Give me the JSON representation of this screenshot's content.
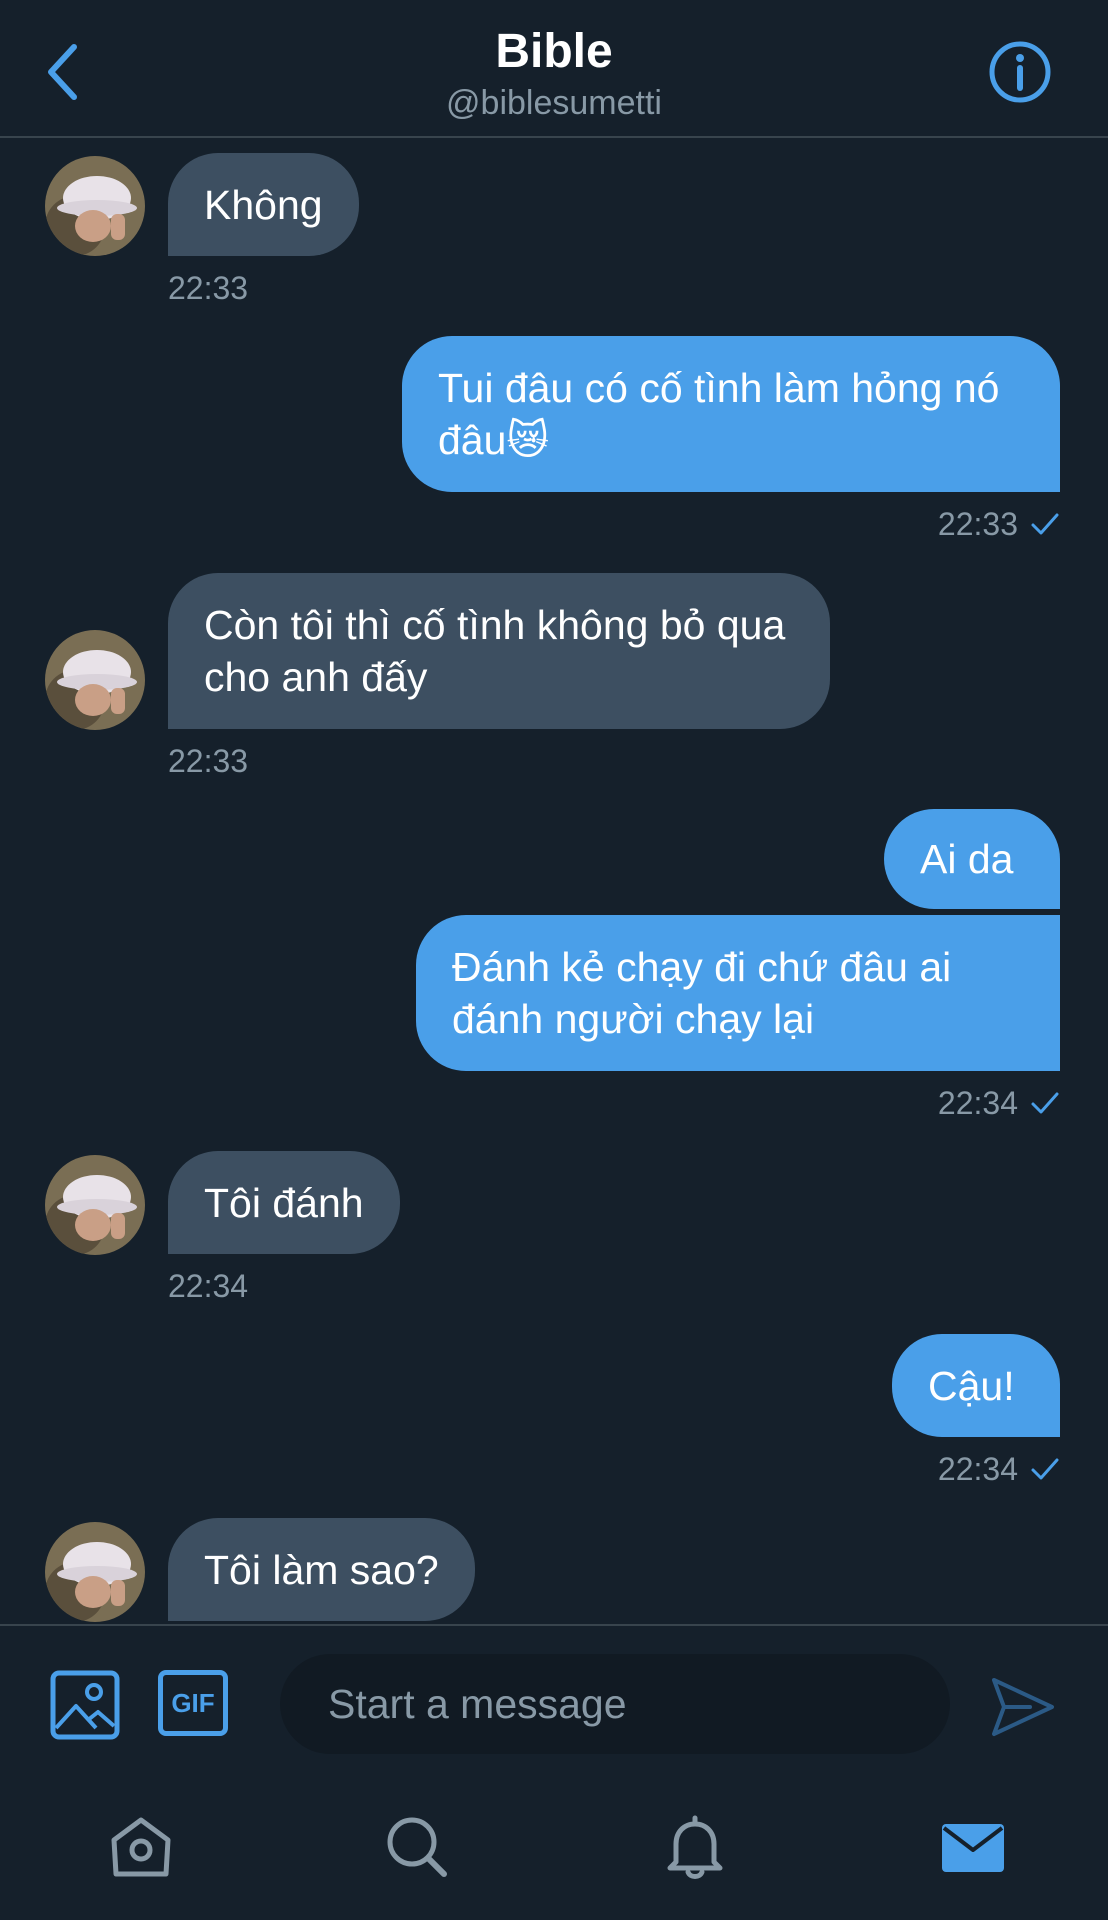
{
  "header": {
    "title": "Bible",
    "handle": "@biblesumetti",
    "back_icon": "chevron-left-icon",
    "info_icon": "info-circle-icon"
  },
  "messages": [
    {
      "side": "in",
      "text": "Không",
      "time": "22:33"
    },
    {
      "side": "out",
      "text": "Tui đâu có cố tình làm hỏng nó đâu😿",
      "time": "22:33",
      "read": true
    },
    {
      "side": "in",
      "text": "Còn tôi thì cố tình không bỏ qua cho anh đấy",
      "time": "22:33"
    },
    {
      "side": "out",
      "text": "Ai da"
    },
    {
      "side": "out",
      "text": "Đánh kẻ chạy đi chứ đâu ai đánh người chạy lại",
      "time": "22:34",
      "read": true
    },
    {
      "side": "in",
      "text": "Tôi đánh",
      "time": "22:34"
    },
    {
      "side": "out",
      "text": "Cậu!",
      "time": "22:34",
      "read": true
    },
    {
      "side": "in",
      "text": "Tôi làm sao?"
    }
  ],
  "composer": {
    "placeholder": "Start a message",
    "gif_label": "GIF",
    "image_icon": "image-icon",
    "send_icon": "send-icon"
  },
  "tabs": [
    {
      "name": "home",
      "icon": "home-icon"
    },
    {
      "name": "search",
      "icon": "search-icon"
    },
    {
      "name": "notifications",
      "icon": "bell-icon"
    },
    {
      "name": "messages",
      "icon": "mail-icon",
      "active": true
    }
  ],
  "colors": {
    "background": "#15202b",
    "accent": "#4a9fe9",
    "incoming_bubble": "#3d4f61",
    "muted": "#8899a6",
    "divider": "#38444d"
  }
}
